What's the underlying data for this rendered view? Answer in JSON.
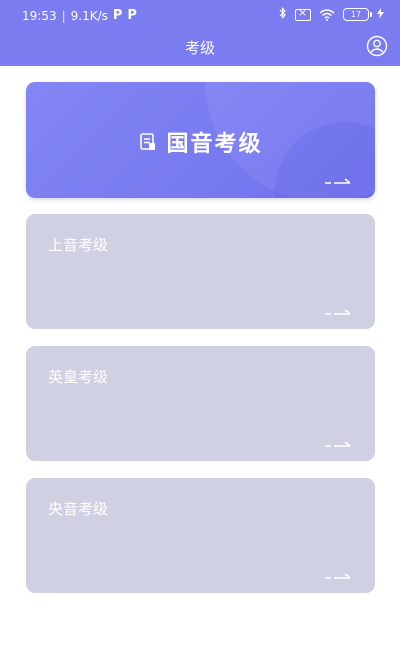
{
  "status_bar": {
    "time": "19:53",
    "speed": "9.1K/s",
    "app_icon_1": "P",
    "app_icon_2": "P",
    "battery": "17"
  },
  "header": {
    "title": "考级"
  },
  "cards": [
    {
      "label": "国音考级"
    },
    {
      "label": "上音考级"
    },
    {
      "label": "英皇考级"
    },
    {
      "label": "央音考级"
    }
  ],
  "colors": {
    "header_bg": "#7b7cf0",
    "primary_card": "#7476f0",
    "gray_card": "#cfd0e2"
  }
}
